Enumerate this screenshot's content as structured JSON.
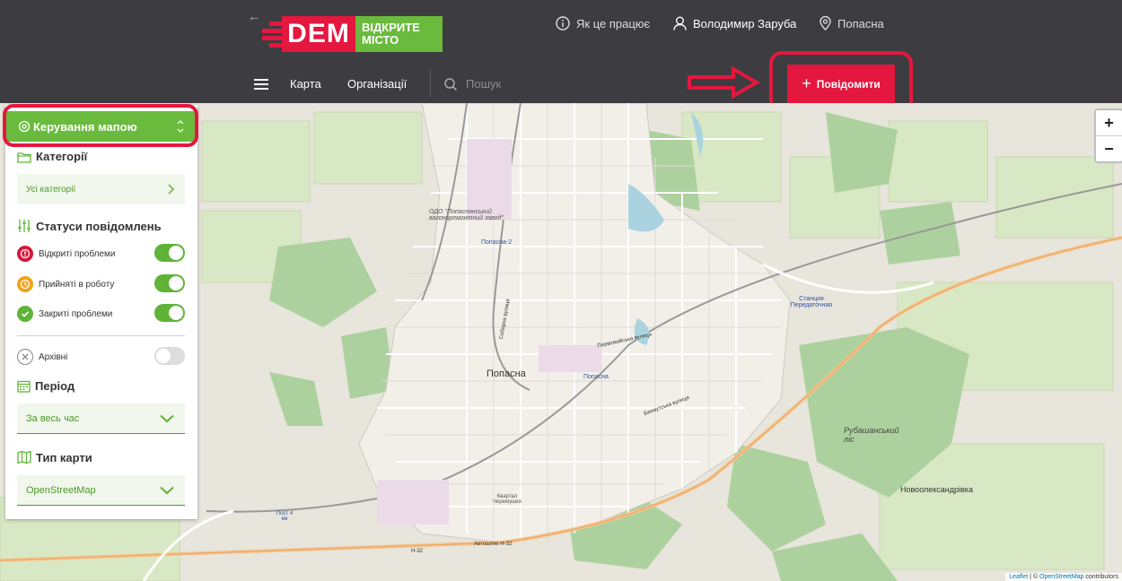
{
  "header": {
    "logo_main": "DEM",
    "logo_sub_line1": "ВІДКРИТЕ",
    "logo_sub_line2": "МІСТО",
    "how_it_works": "Як це працює",
    "user_name": "Володимир Заруба",
    "city": "Попасна"
  },
  "nav": {
    "map": "Карта",
    "organizations": "Організації",
    "search_placeholder": "Пошук",
    "report_button": "Повідомити"
  },
  "panel": {
    "title": "Керування мапою",
    "categories_title": "Категорії",
    "categories_value": "Усі категорії",
    "statuses_title": "Статуси повідомлень",
    "statuses": [
      {
        "label": "Відкриті проблеми",
        "on": true,
        "color": "#d6173b"
      },
      {
        "label": "Прийняті в роботу",
        "on": true,
        "color": "#f0a21a"
      },
      {
        "label": "Закриті проблеми",
        "on": true,
        "color": "#5fb337"
      }
    ],
    "archive": {
      "label": "Архівні",
      "on": false
    },
    "period_title": "Період",
    "period_value": "За весь час",
    "maptype_title": "Тип карти",
    "maptype_value": "OpenStreetMap"
  },
  "map": {
    "zoom_in": "+",
    "zoom_out": "−",
    "attribution_leaflet": "Leaflet",
    "attribution_sep": " | © ",
    "attribution_osm": "OpenStreetMap",
    "attribution_tail": " contributors",
    "labels": {
      "city": "Попасна",
      "station1": "Попасна",
      "station2": "Попасна-2",
      "station3": "Станция Передаточная",
      "forest": "Рубашанський ліс",
      "village": "Новоолександрівка",
      "plant": "ОДО \"Попаснянський вагоноремонтний завод\"",
      "road1": "Автошлях Н-32",
      "road2": "Н-32",
      "street1": "Бахмутська вулиця",
      "street2": "Первомайська вулиця",
      "street3": "Соборна вулиця",
      "post": "Пост 4 км",
      "district": "Квартал Черемушки"
    }
  },
  "colors": {
    "accent_red": "#e4173f",
    "accent_green": "#6aba3d",
    "header_bg": "#3d3c40"
  }
}
